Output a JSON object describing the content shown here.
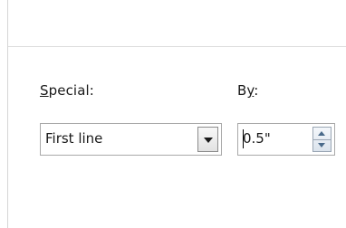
{
  "indentation": {
    "special": {
      "label_accesskey": "S",
      "label_rest": "pecial:",
      "selected": "First line"
    },
    "by": {
      "label_plain": "B",
      "label_accesskey": "y",
      "label_suffix": ":",
      "value": "0.5\""
    }
  },
  "icons": {
    "dropdown": "chevron-down-icon",
    "spin_up": "spin-up-arrow-icon",
    "spin_down": "spin-down-arrow-icon"
  }
}
